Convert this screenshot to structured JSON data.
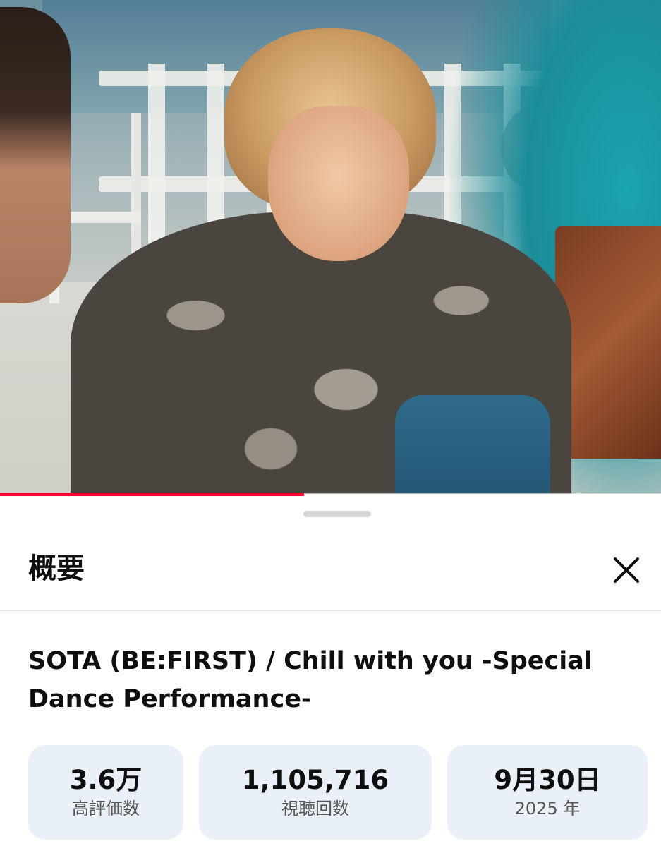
{
  "video": {
    "progress_fraction": 0.46
  },
  "sheet": {
    "title": "概要",
    "close_icon": "close-icon"
  },
  "description": {
    "video_title": "SOTA (BE:FIRST) / Chill with you -Special Dance Performance-"
  },
  "stats": {
    "likes": {
      "value": "3.6万",
      "label": "高評価数"
    },
    "views": {
      "value": "1,105,716",
      "label": "視聴回数"
    },
    "date": {
      "value": "9月30日",
      "label": "2025 年"
    }
  },
  "colors": {
    "progress": "#ff0033",
    "stat_chip_bg": "#eaf0f8"
  }
}
